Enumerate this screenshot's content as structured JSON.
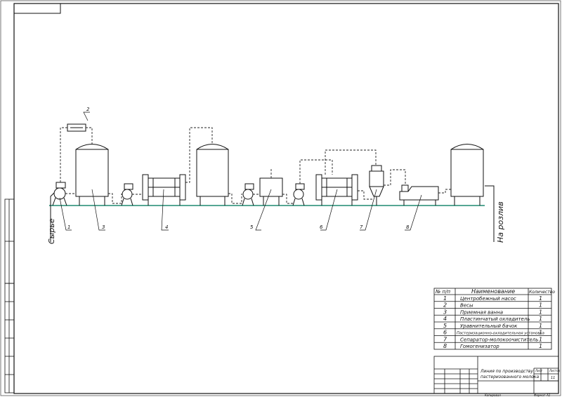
{
  "flow": {
    "input_label": "Сырье",
    "output_label": "На розлив"
  },
  "callouts": [
    "1",
    "2",
    "3",
    "4",
    "5",
    "6",
    "7",
    "8"
  ],
  "spec_table": {
    "headers": [
      "№ п/п",
      "Наименование",
      "Количество"
    ],
    "rows": [
      {
        "num": "1",
        "name": "Центробежный насос",
        "qty": "1"
      },
      {
        "num": "2",
        "name": "Весы",
        "qty": "1"
      },
      {
        "num": "3",
        "name": "Приемная ванна",
        "qty": "1"
      },
      {
        "num": "4",
        "name": "Пластинчатый охладитель",
        "qty": "1"
      },
      {
        "num": "5",
        "name": "Уравнительный бачок",
        "qty": "1"
      },
      {
        "num": "6",
        "name": "Пастеризационно-охладительная установка",
        "qty": "1"
      },
      {
        "num": "7",
        "name": "Сепаратор-молокоочиститель",
        "qty": "1"
      },
      {
        "num": "8",
        "name": "Гомогенизатор",
        "qty": "1"
      }
    ]
  },
  "title_block": {
    "title_line1": "Линия по производству",
    "title_line2": "пастеризованного молока",
    "sheet_label": "Лист",
    "sheets_label": "Листов",
    "sheets_value": "11",
    "format_label": "Формат",
    "format_value": "А1",
    "copied_label": "Копировал"
  },
  "colors": {
    "ground": "#1f8a70",
    "lines": "#111111"
  }
}
